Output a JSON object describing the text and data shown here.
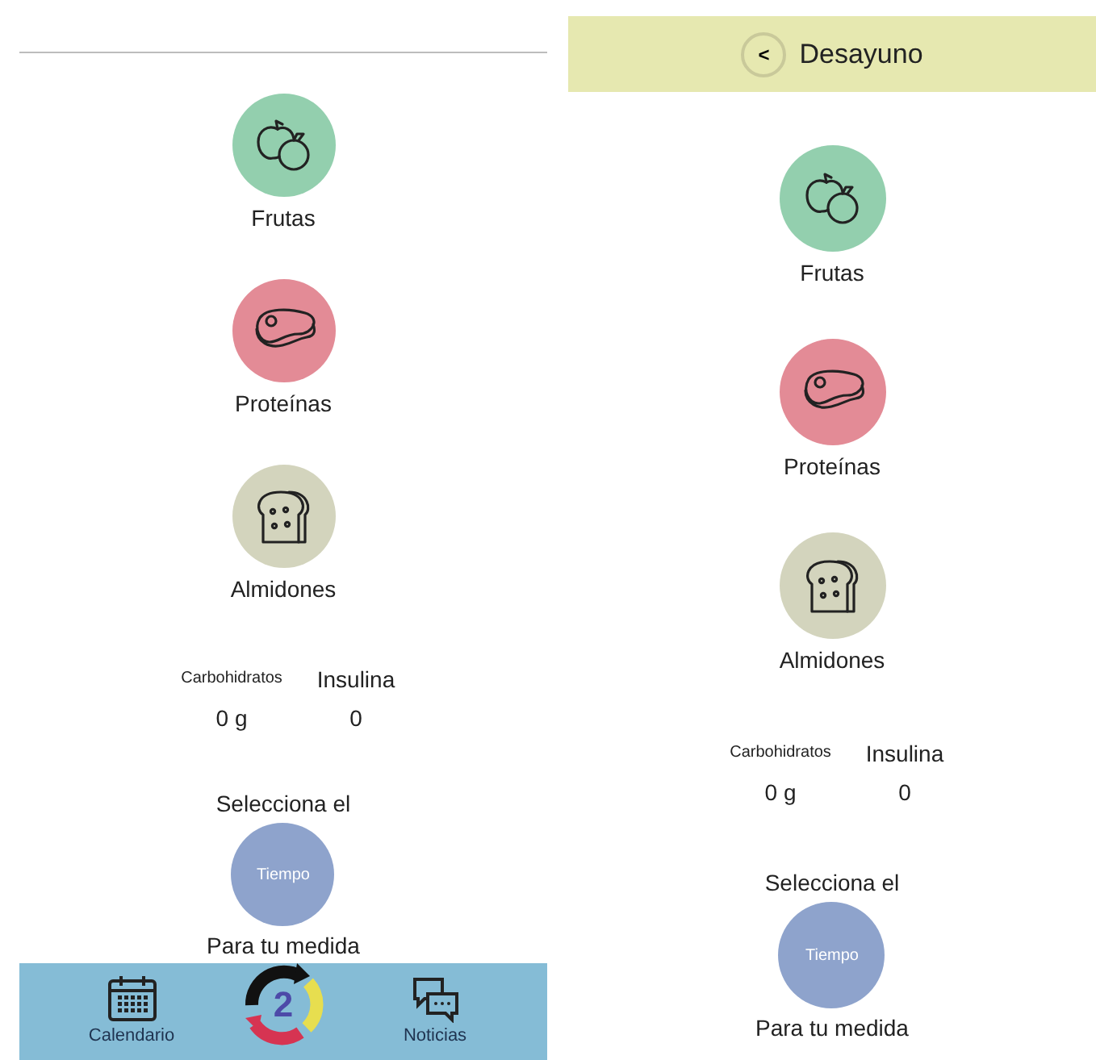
{
  "screens": [
    {
      "kind": "tab",
      "categories": [
        {
          "kind": "fruit",
          "label": "Frutas",
          "color": "#93cfae"
        },
        {
          "kind": "meat",
          "label": "Proteínas",
          "color": "#e38b96"
        },
        {
          "kind": "bread",
          "label": "Almidones",
          "color": "#d3d4bd"
        }
      ],
      "stats": {
        "carbs_label": "Carbohidratos",
        "insulin_label": "Insulina",
        "carbs_value": "0 g",
        "insulin_value": "0"
      },
      "time_picker": {
        "prompt": "Selecciona el",
        "button": "Tiempo",
        "caption": "Para tu medida"
      },
      "nav": {
        "items": [
          {
            "kind": "calendar",
            "label": "Calendario"
          },
          {
            "kind": "logo",
            "label": "2"
          },
          {
            "kind": "news",
            "label": "Noticias"
          }
        ]
      }
    },
    {
      "kind": "meal",
      "header": {
        "back": "<",
        "title": "Desayuno"
      },
      "categories": [
        {
          "kind": "fruit",
          "label": "Frutas",
          "color": "#93cfae"
        },
        {
          "kind": "meat",
          "label": "Proteínas",
          "color": "#e38b96"
        },
        {
          "kind": "bread",
          "label": "Almidones",
          "color": "#d3d4bd"
        }
      ],
      "stats": {
        "carbs_label": "Carbohidratos",
        "insulin_label": "Insulina",
        "carbs_value": "0 g",
        "insulin_value": "0"
      },
      "time_picker": {
        "prompt": "Selecciona el",
        "button": "Tiempo",
        "caption": "Para tu medida"
      }
    }
  ]
}
